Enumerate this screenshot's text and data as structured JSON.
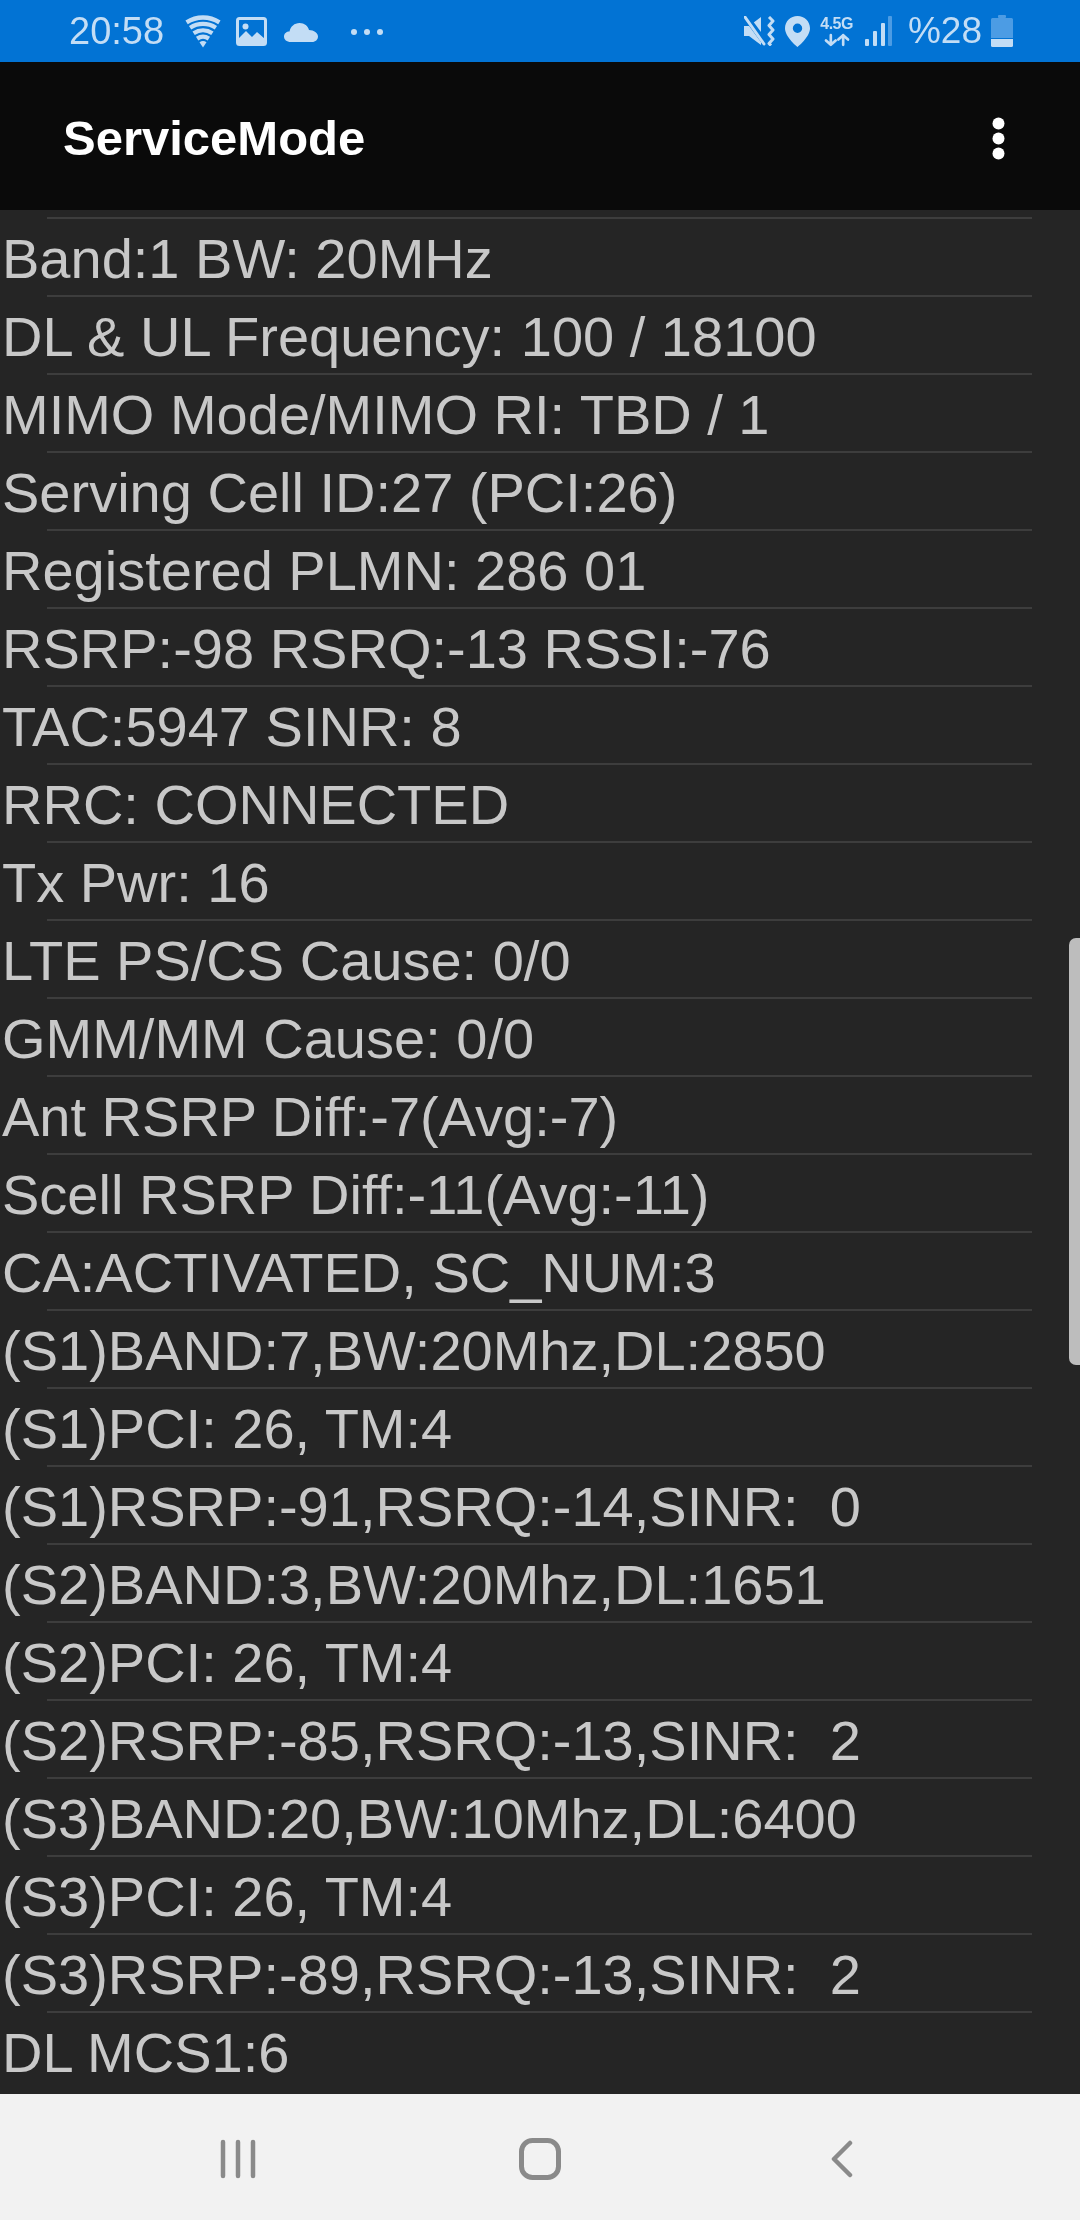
{
  "status_bar": {
    "time": "20:58",
    "network_type": "4.5G",
    "battery_percent": "%28"
  },
  "app_bar": {
    "title": "ServiceMode"
  },
  "lines": [
    "Band:1 BW: 20MHz",
    "DL & UL Frequency: 100 / 18100",
    "MIMO Mode/MIMO RI: TBD / 1",
    "Serving Cell ID:27 (PCI:26)",
    "Registered PLMN: 286 01",
    "RSRP:-98 RSRQ:-13 RSSI:-76",
    "TAC:5947 SINR: 8",
    "RRC: CONNECTED",
    "Tx Pwr: 16",
    "LTE PS/CS Cause: 0/0",
    "GMM/MM Cause: 0/0",
    "Ant RSRP Diff:-7(Avg:-7)",
    "Scell RSRP Diff:-11(Avg:-11)",
    "CA:ACTIVATED, SC_NUM:3",
    "(S1)BAND:7,BW:20Mhz,DL:2850",
    "(S1)PCI: 26, TM:4",
    "(S1)RSRP:-91,RSRQ:-14,SINR:  0",
    "(S2)BAND:3,BW:20Mhz,DL:1651",
    "(S2)PCI: 26, TM:4",
    "(S2)RSRP:-85,RSRQ:-13,SINR:  2",
    "(S3)BAND:20,BW:10Mhz,DL:6400",
    "(S3)PCI: 26, TM:4",
    "(S3)RSRP:-89,RSRQ:-13,SINR:  2",
    "DL MCS1:6"
  ]
}
